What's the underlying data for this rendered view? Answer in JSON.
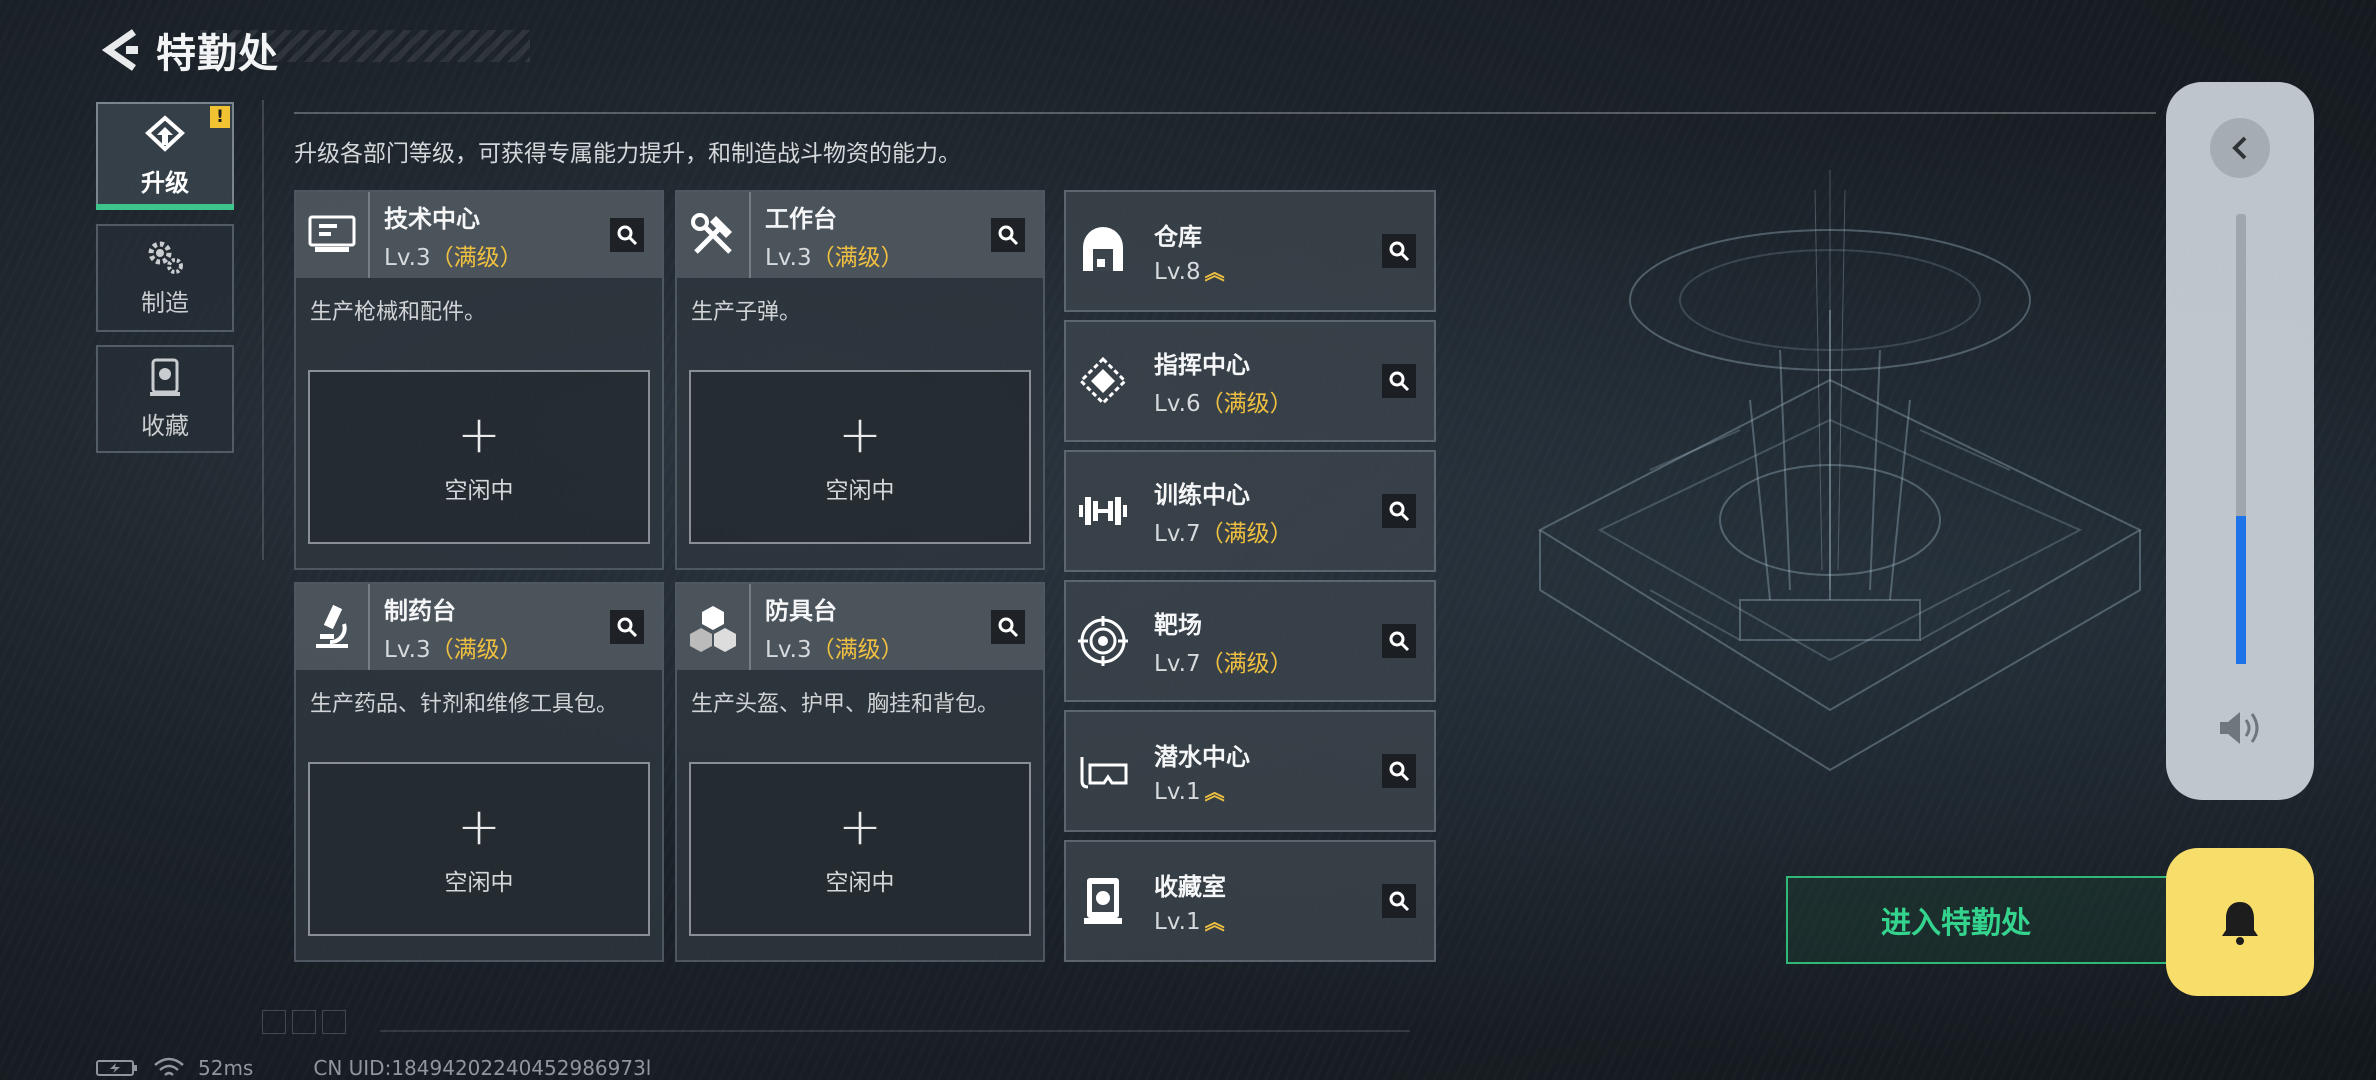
{
  "header": {
    "title": "特勤处"
  },
  "tabs": [
    {
      "label": "升级",
      "active": true,
      "badge": "!"
    },
    {
      "label": "制造",
      "active": false
    },
    {
      "label": "收藏",
      "active": false
    }
  ],
  "description": "升级各部门等级，可获得专属能力提升，和制造战斗物资的能力。",
  "production": [
    {
      "name": "技术中心",
      "level": "Lv.3",
      "status": "（满级）",
      "desc": "生产枪械和配件。",
      "slot_plus": "+",
      "slot_text": "空闲中"
    },
    {
      "name": "工作台",
      "level": "Lv.3",
      "status": "（满级）",
      "desc": "生产子弹。",
      "slot_plus": "+",
      "slot_text": "空闲中"
    },
    {
      "name": "制药台",
      "level": "Lv.3",
      "status": "（满级）",
      "desc": "生产药品、针剂和维修工具包。",
      "slot_plus": "+",
      "slot_text": "空闲中"
    },
    {
      "name": "防具台",
      "level": "Lv.3",
      "status": "（满级）",
      "desc": "生产头盔、护甲、胸挂和背包。",
      "slot_plus": "+",
      "slot_text": "空闲中"
    }
  ],
  "facilities": [
    {
      "name": "仓库",
      "level": "Lv.8",
      "status": "",
      "upgradable": true
    },
    {
      "name": "指挥中心",
      "level": "Lv.6",
      "status": "（满级）",
      "upgradable": false
    },
    {
      "name": "训练中心",
      "level": "Lv.7",
      "status": "（满级）",
      "upgradable": false
    },
    {
      "name": "靶场",
      "level": "Lv.7",
      "status": "（满级）",
      "upgradable": false
    },
    {
      "name": "潜水中心",
      "level": "Lv.1",
      "status": "",
      "upgradable": true
    },
    {
      "name": "收藏室",
      "level": "Lv.1",
      "status": "",
      "upgradable": true
    }
  ],
  "enter_button": "进入特勤处",
  "volume": {
    "level": 0.33
  },
  "status_bar": {
    "ping": "52ms",
    "uid": "CN UID:18494202240452986973l"
  },
  "colors": {
    "accent_green": "#34d48e",
    "max_level_gold": "#f0c040",
    "volume_blue": "#1f73e8",
    "bell_yellow": "#f7dd6a"
  },
  "icons": {
    "back": "back-arrow-icon",
    "search": "search-icon",
    "speaker": "speaker-icon",
    "bell": "bell-icon",
    "upgrade": "upgrade-house-icon",
    "craft": "gears-icon",
    "collection": "collection-icon"
  }
}
